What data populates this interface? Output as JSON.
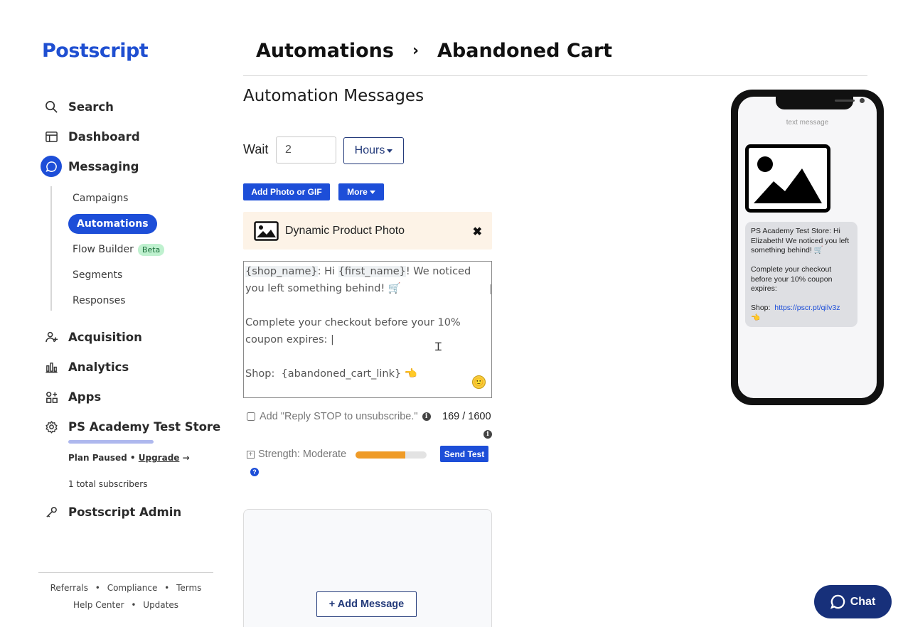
{
  "sidebar": {
    "logo": "Postscript",
    "nav": {
      "search": "Search",
      "dashboard": "Dashboard",
      "messaging": "Messaging",
      "acquisition": "Acquisition",
      "analytics": "Analytics",
      "apps": "Apps",
      "store": "PS Academy Test Store",
      "admin": "Postscript Admin"
    },
    "messaging_sub": {
      "campaigns": "Campaigns",
      "automations": "Automations",
      "flow_builder": "Flow Builder",
      "beta_badge": "Beta",
      "segments": "Segments",
      "responses": "Responses"
    },
    "plan_status": "Plan Paused •",
    "plan_upgrade": "Upgrade",
    "plan_arrow": "→",
    "subscribers": "1 total subscribers",
    "footer": {
      "referrals": "Referrals",
      "compliance": "Compliance",
      "terms": "Terms",
      "help_center": "Help Center",
      "updates": "Updates",
      "separator": "•"
    }
  },
  "header": {
    "crumb_parent": "Automations",
    "crumb_separator": "›",
    "crumb_current": "Abandoned Cart",
    "section_title": "Automation Messages"
  },
  "wait": {
    "label": "Wait",
    "value": "2",
    "unit": "Hours"
  },
  "toolbar": {
    "add_photo": "Add Photo or GIF",
    "more": "More"
  },
  "dynamic_photo": {
    "label": "Dynamic Product Photo",
    "close": "✖"
  },
  "message": {
    "token_shop": "{shop_name}",
    "text_1": ": Hi ",
    "token_first": "{first_name}",
    "text_2": "! We noticed you left something behind! 🛒\n\nComplete your checkout before your 10% coupon expires: |\n\nShop:  {abandoned_cart_link} 👈"
  },
  "options": {
    "reply_stop": "Add \"Reply STOP to unsubscribe.\"",
    "info_glyph": "i",
    "char_count": "169 / 1600",
    "strength_label": "Strength: Moderate",
    "strength_level": 0.7,
    "send_test": "Send Test",
    "help_glyph": "?",
    "emoji_glyph": "🙂"
  },
  "add_message": "+ Add Message",
  "preview": {
    "label": "text message",
    "bubble_text": "PS Academy Test Store: Hi Elizabeth! We noticed you left something behind! 🛒\n\nComplete your checkout before your 10% coupon expires:\n\nShop:  ",
    "bubble_link": "https://pscr.pt/qilv3z",
    "bubble_end": "\n👈"
  },
  "chat": "Chat",
  "colors": {
    "brand": "#1d4ed8",
    "navy": "#17307a",
    "strength": "#ef9b27",
    "photo_card": "#fdf3e7"
  }
}
